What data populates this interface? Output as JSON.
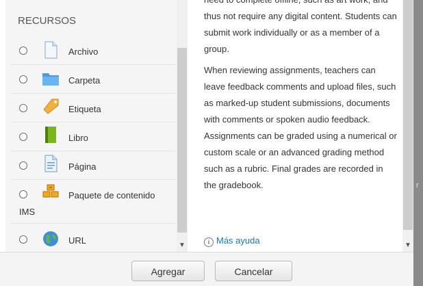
{
  "resources": {
    "heading": "RECURSOS",
    "items": [
      {
        "label": "Archivo",
        "icon": "file-icon"
      },
      {
        "label": "Carpeta",
        "icon": "folder-icon"
      },
      {
        "label": "Etiqueta",
        "icon": "label-tag-icon"
      },
      {
        "label": "Libro",
        "icon": "book-icon"
      },
      {
        "label": "Página",
        "icon": "page-icon"
      },
      {
        "label": "Paquete de contenido",
        "label_line2": "IMS",
        "icon": "ims-package-icon"
      },
      {
        "label": "URL",
        "icon": "url-globe-icon"
      }
    ]
  },
  "help": {
    "lines_top": "need to complete offline, such as art work, and thus not require any digital content. Students can submit work individually or as a member of a group.",
    "paragraph2": "When reviewing assignments, teachers can leave feedback comments and upload files, such as marked-up student submissions, documents with comments or spoken audio feedback. Assignments can be graded using a numerical or custom scale or an advanced grading method such as a rubric. Final grades are recorded in the gradebook.",
    "more_help_label": "Más ayuda",
    "info_glyph": "i"
  },
  "background": {
    "peek_text": "r"
  },
  "footer": {
    "add_label": "Agregar",
    "cancel_label": "Cancelar"
  },
  "colors": {
    "link": "#1a78ad",
    "panel_bg": "#f5f5f5",
    "footer_bg": "#f4f4f4"
  }
}
